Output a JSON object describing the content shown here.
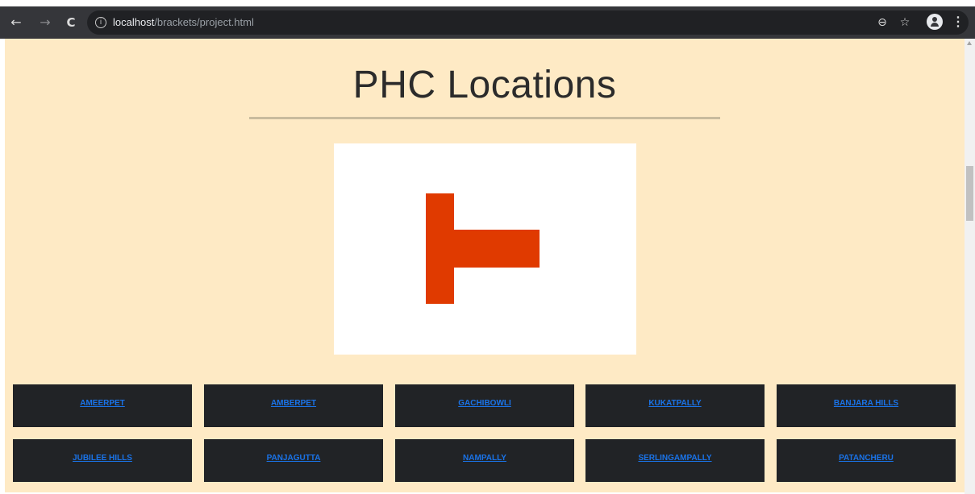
{
  "browser": {
    "back_icon": "←",
    "forward_icon": "→",
    "reload_icon": "C",
    "info_icon": "i",
    "url_host": "localhost",
    "url_path": "/brackets/project.html",
    "zoom_icon": "⊖",
    "star_icon": "☆",
    "menu_icon": "⋮"
  },
  "page": {
    "title": "PHC Locations",
    "logo_color": "#e03a00",
    "locations_row1": [
      "AMEERPET",
      "AMBERPET",
      "GACHIBOWLI",
      "KUKATPALLY",
      "BANJARA HILLS"
    ],
    "locations_row2": [
      "JUBILEE HILLS",
      "PANJAGUTTA",
      "NAMPALLY",
      "SERLINGAMPALLY",
      "PATANCHERU"
    ]
  }
}
